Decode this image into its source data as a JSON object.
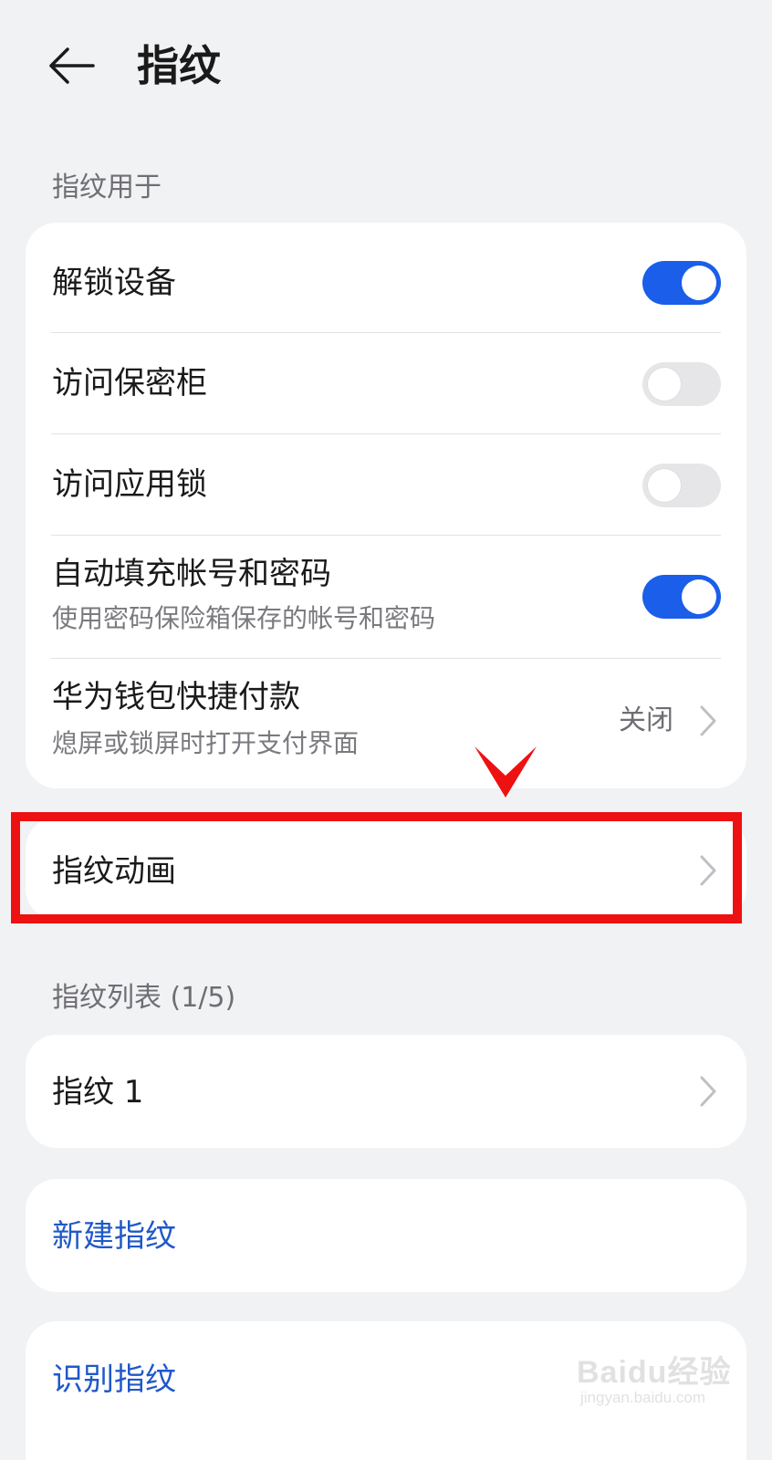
{
  "header": {
    "title": "指纹"
  },
  "section_usage": {
    "label": "指纹用于"
  },
  "usage_items": [
    {
      "title": "解锁设备",
      "toggle": "on"
    },
    {
      "title": "访问保密柜",
      "toggle": "off"
    },
    {
      "title": "访问应用锁",
      "toggle": "off"
    },
    {
      "title": "自动填充帐号和密码",
      "subtitle": "使用密码保险箱保存的帐号和密码",
      "toggle": "on"
    },
    {
      "title": "华为钱包快捷付款",
      "subtitle": "熄屏或锁屏时打开支付界面",
      "value": "关闭"
    }
  ],
  "animation": {
    "title": "指纹动画"
  },
  "section_list": {
    "label": "指纹列表 (1/5)"
  },
  "fingerprints": [
    {
      "title": "指纹 1"
    }
  ],
  "actions": {
    "new": "新建指纹",
    "identify": "识别指纹"
  },
  "watermark": {
    "brand": "Baidu经验",
    "url": "jingyan.baidu.com"
  },
  "colors": {
    "accent": "#1a5eea",
    "link": "#1f58c8",
    "highlight": "#ee1111",
    "background": "#f1f2f4"
  }
}
